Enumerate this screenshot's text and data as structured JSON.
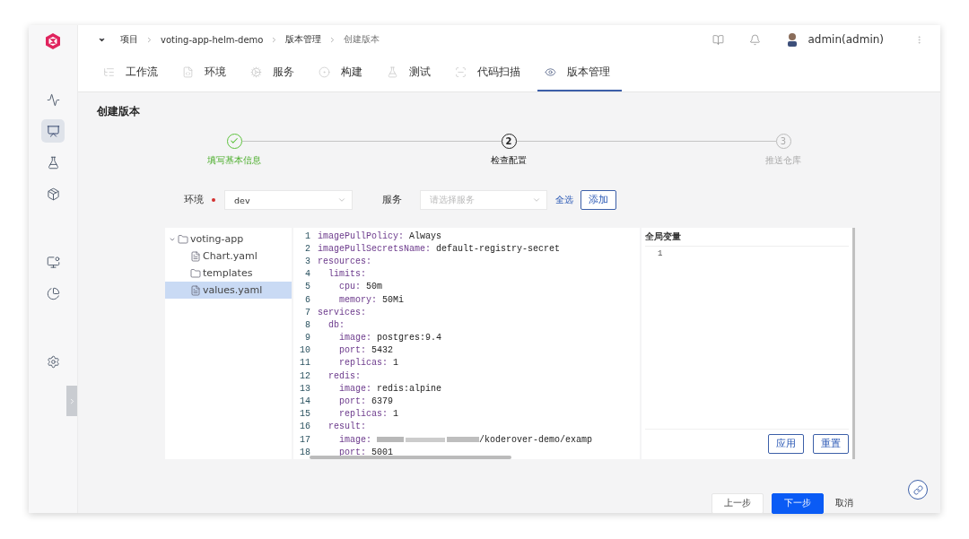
{
  "breadcrumb": {
    "items": [
      "项目",
      "voting-app-helm-demo",
      "版本管理",
      "创建版本"
    ]
  },
  "header": {
    "user": "admin(admin)"
  },
  "nav_tabs": [
    {
      "label": "工作流",
      "selected": false
    },
    {
      "label": "环境",
      "selected": false
    },
    {
      "label": "服务",
      "selected": false
    },
    {
      "label": "构建",
      "selected": false
    },
    {
      "label": "测试",
      "selected": false
    },
    {
      "label": "代码扫描",
      "selected": false
    },
    {
      "label": "版本管理",
      "selected": true
    }
  ],
  "sidebar": {
    "items": [
      {
        "selected": false
      },
      {
        "selected": true
      },
      {
        "selected": false
      },
      {
        "selected": false
      },
      {
        "selected": false
      },
      {
        "selected": false
      },
      {
        "selected": false
      }
    ]
  },
  "page_title": "创建版本",
  "steps": [
    {
      "label": "填写基本信息",
      "completed": true,
      "active": false
    },
    {
      "number": "2",
      "label": "检查配置",
      "completed": false,
      "active": true
    },
    {
      "number": "3",
      "label": "推送仓库",
      "completed": false,
      "active": false
    }
  ],
  "filters": {
    "env": {
      "label": "环境",
      "required": true,
      "value": "dev"
    },
    "service": {
      "label": "服务",
      "placeholder": "请选择服务"
    },
    "select_all": "全选",
    "add_button": "添加"
  },
  "file_tree": [
    {
      "name": "voting-app",
      "kind": "folder",
      "expanded": true,
      "selected": false,
      "children": [
        {
          "name": "Chart.yaml",
          "kind": "file",
          "selected": false
        },
        {
          "name": "templates",
          "kind": "folder",
          "selected": false
        },
        {
          "name": "values.yaml",
          "kind": "file",
          "selected": true
        }
      ]
    }
  ],
  "code_editor": {
    "lines": [
      {
        "number": "1",
        "text": "imagePullPolicy: Always"
      },
      {
        "number": "2",
        "text": "imagePullSecretsName: default-registry-secret"
      },
      {
        "number": "3",
        "text": "resources:"
      },
      {
        "number": "4",
        "text": "  limits:"
      },
      {
        "number": "5",
        "text": "    cpu: 50m"
      },
      {
        "number": "6",
        "text": "    memory: 50Mi"
      },
      {
        "number": "7",
        "text": "services:"
      },
      {
        "number": "8",
        "text": "  db:"
      },
      {
        "number": "9",
        "text": "    image: postgres:9.4"
      },
      {
        "number": "10",
        "text": "    port: 5432"
      },
      {
        "number": "11",
        "text": "    replicas: 1"
      },
      {
        "number": "12",
        "text": "  redis:"
      },
      {
        "number": "13",
        "text": "    image: redis:alpine"
      },
      {
        "number": "14",
        "text": "    port: 6379"
      },
      {
        "number": "15",
        "text": "    replicas: 1"
      },
      {
        "number": "16",
        "text": "  result:"
      },
      {
        "number": "17",
        "text": "    image: ",
        "redacted": true,
        "rest": "/koderover-demo/examp"
      },
      {
        "number": "18",
        "text": "    port: 5001"
      }
    ]
  },
  "global_vars": {
    "title": "全局变量",
    "lines": [
      "1"
    ],
    "buttons": [
      "应用",
      "重置"
    ]
  },
  "footer": {
    "buttons": [
      {
        "label": "上一步",
        "kind": "default"
      },
      {
        "label": "下一步",
        "kind": "primary"
      },
      {
        "label": "取消",
        "kind": "text"
      }
    ]
  }
}
